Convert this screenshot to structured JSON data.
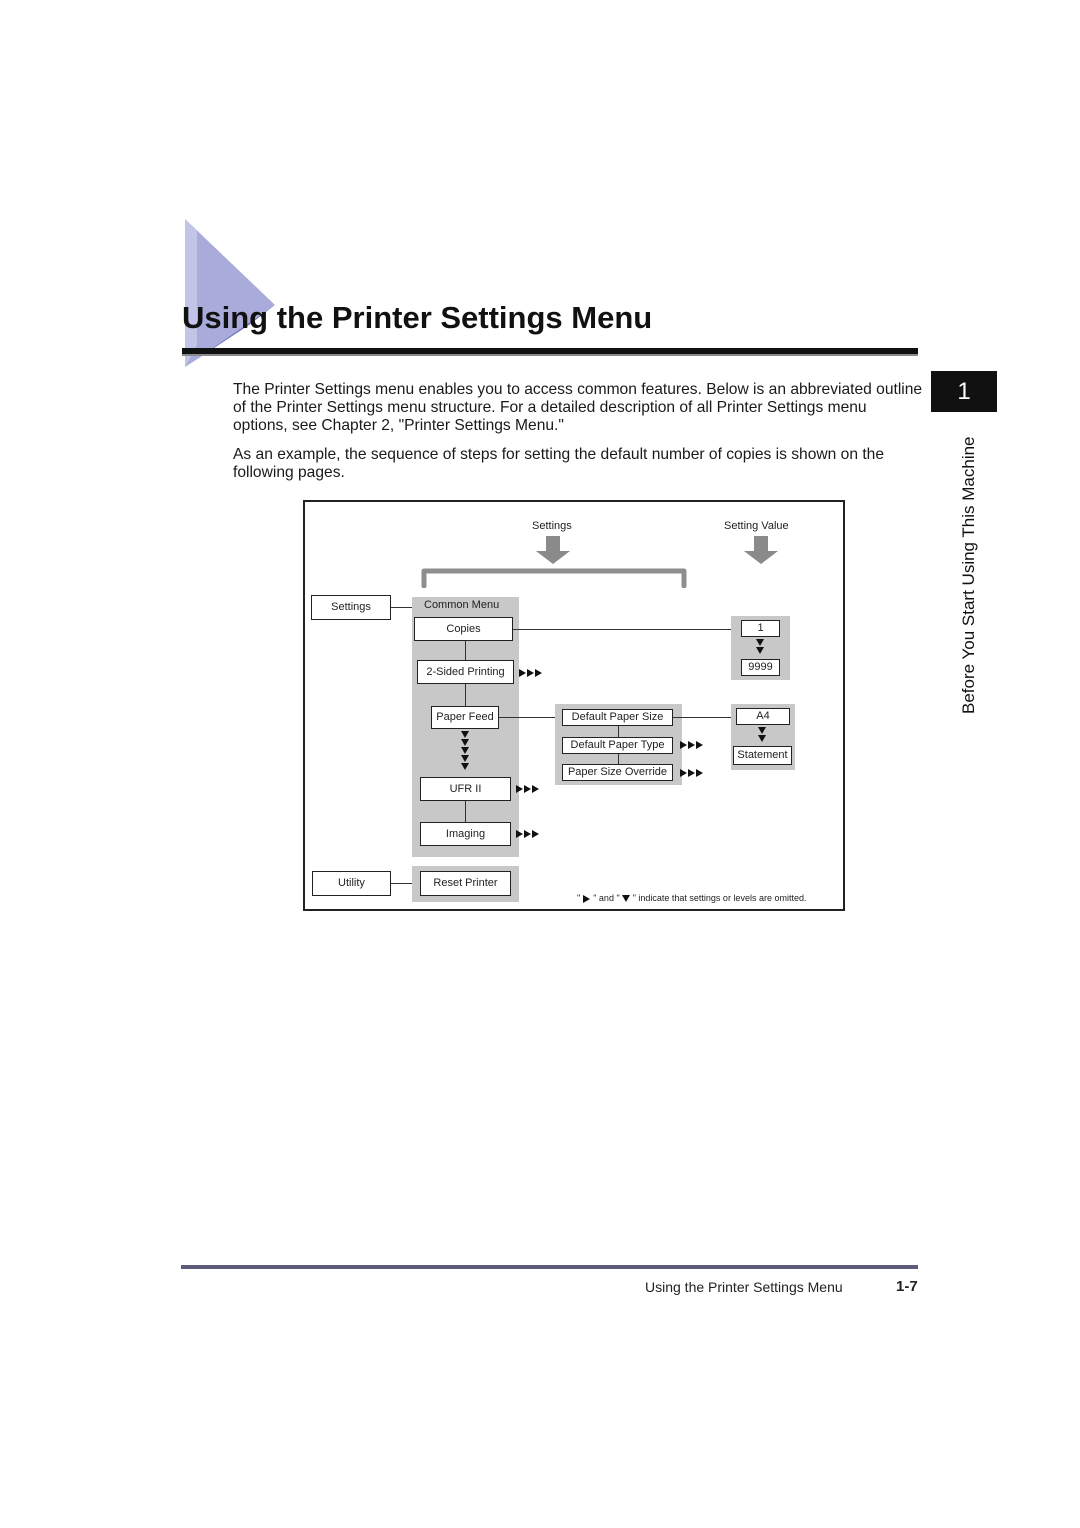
{
  "header": {
    "title": "Using the Printer Settings Menu",
    "accent_color": "#8c8fd0"
  },
  "chapter_tab": {
    "number": "1",
    "label": "Before You Start Using This Machine"
  },
  "body": {
    "paragraphs": [
      "The Printer Settings menu enables you to access common features. Below is an abbreviated outline of the Printer Settings menu structure. For a detailed description of all Printer Settings menu options, see Chapter 2, \"Printer Settings Menu.\"",
      "As an example, the sequence of steps for setting the default number of copies is shown on the following pages."
    ]
  },
  "diagram": {
    "column_headers": {
      "settings": "Settings",
      "setting_value": "Setting Value"
    },
    "left_menus": {
      "settings": "Settings",
      "utility": "Utility"
    },
    "common_menu": {
      "title": "Common Menu",
      "items": [
        "Copies",
        "2-Sided Printing",
        "Paper Feed",
        "UFR II",
        "Imaging"
      ]
    },
    "utility_menu": {
      "items": [
        "Reset Printer"
      ]
    },
    "paper_feed_submenu": {
      "items": [
        "Default Paper Size",
        "Default Paper Type",
        "Paper Size Override"
      ]
    },
    "copies_values": {
      "min": "1",
      "max": "9999"
    },
    "paper_size_values": {
      "first": "A4",
      "last": "Statement"
    },
    "footnote": {
      "prefix": "\"",
      "mid1": "\" and \"",
      "suffix": "\" indicate that settings or levels are omitted."
    }
  },
  "footer": {
    "section_title": "Using the Printer Settings Menu",
    "page_number": "1-7",
    "rule_color": "#5b5b7a"
  }
}
